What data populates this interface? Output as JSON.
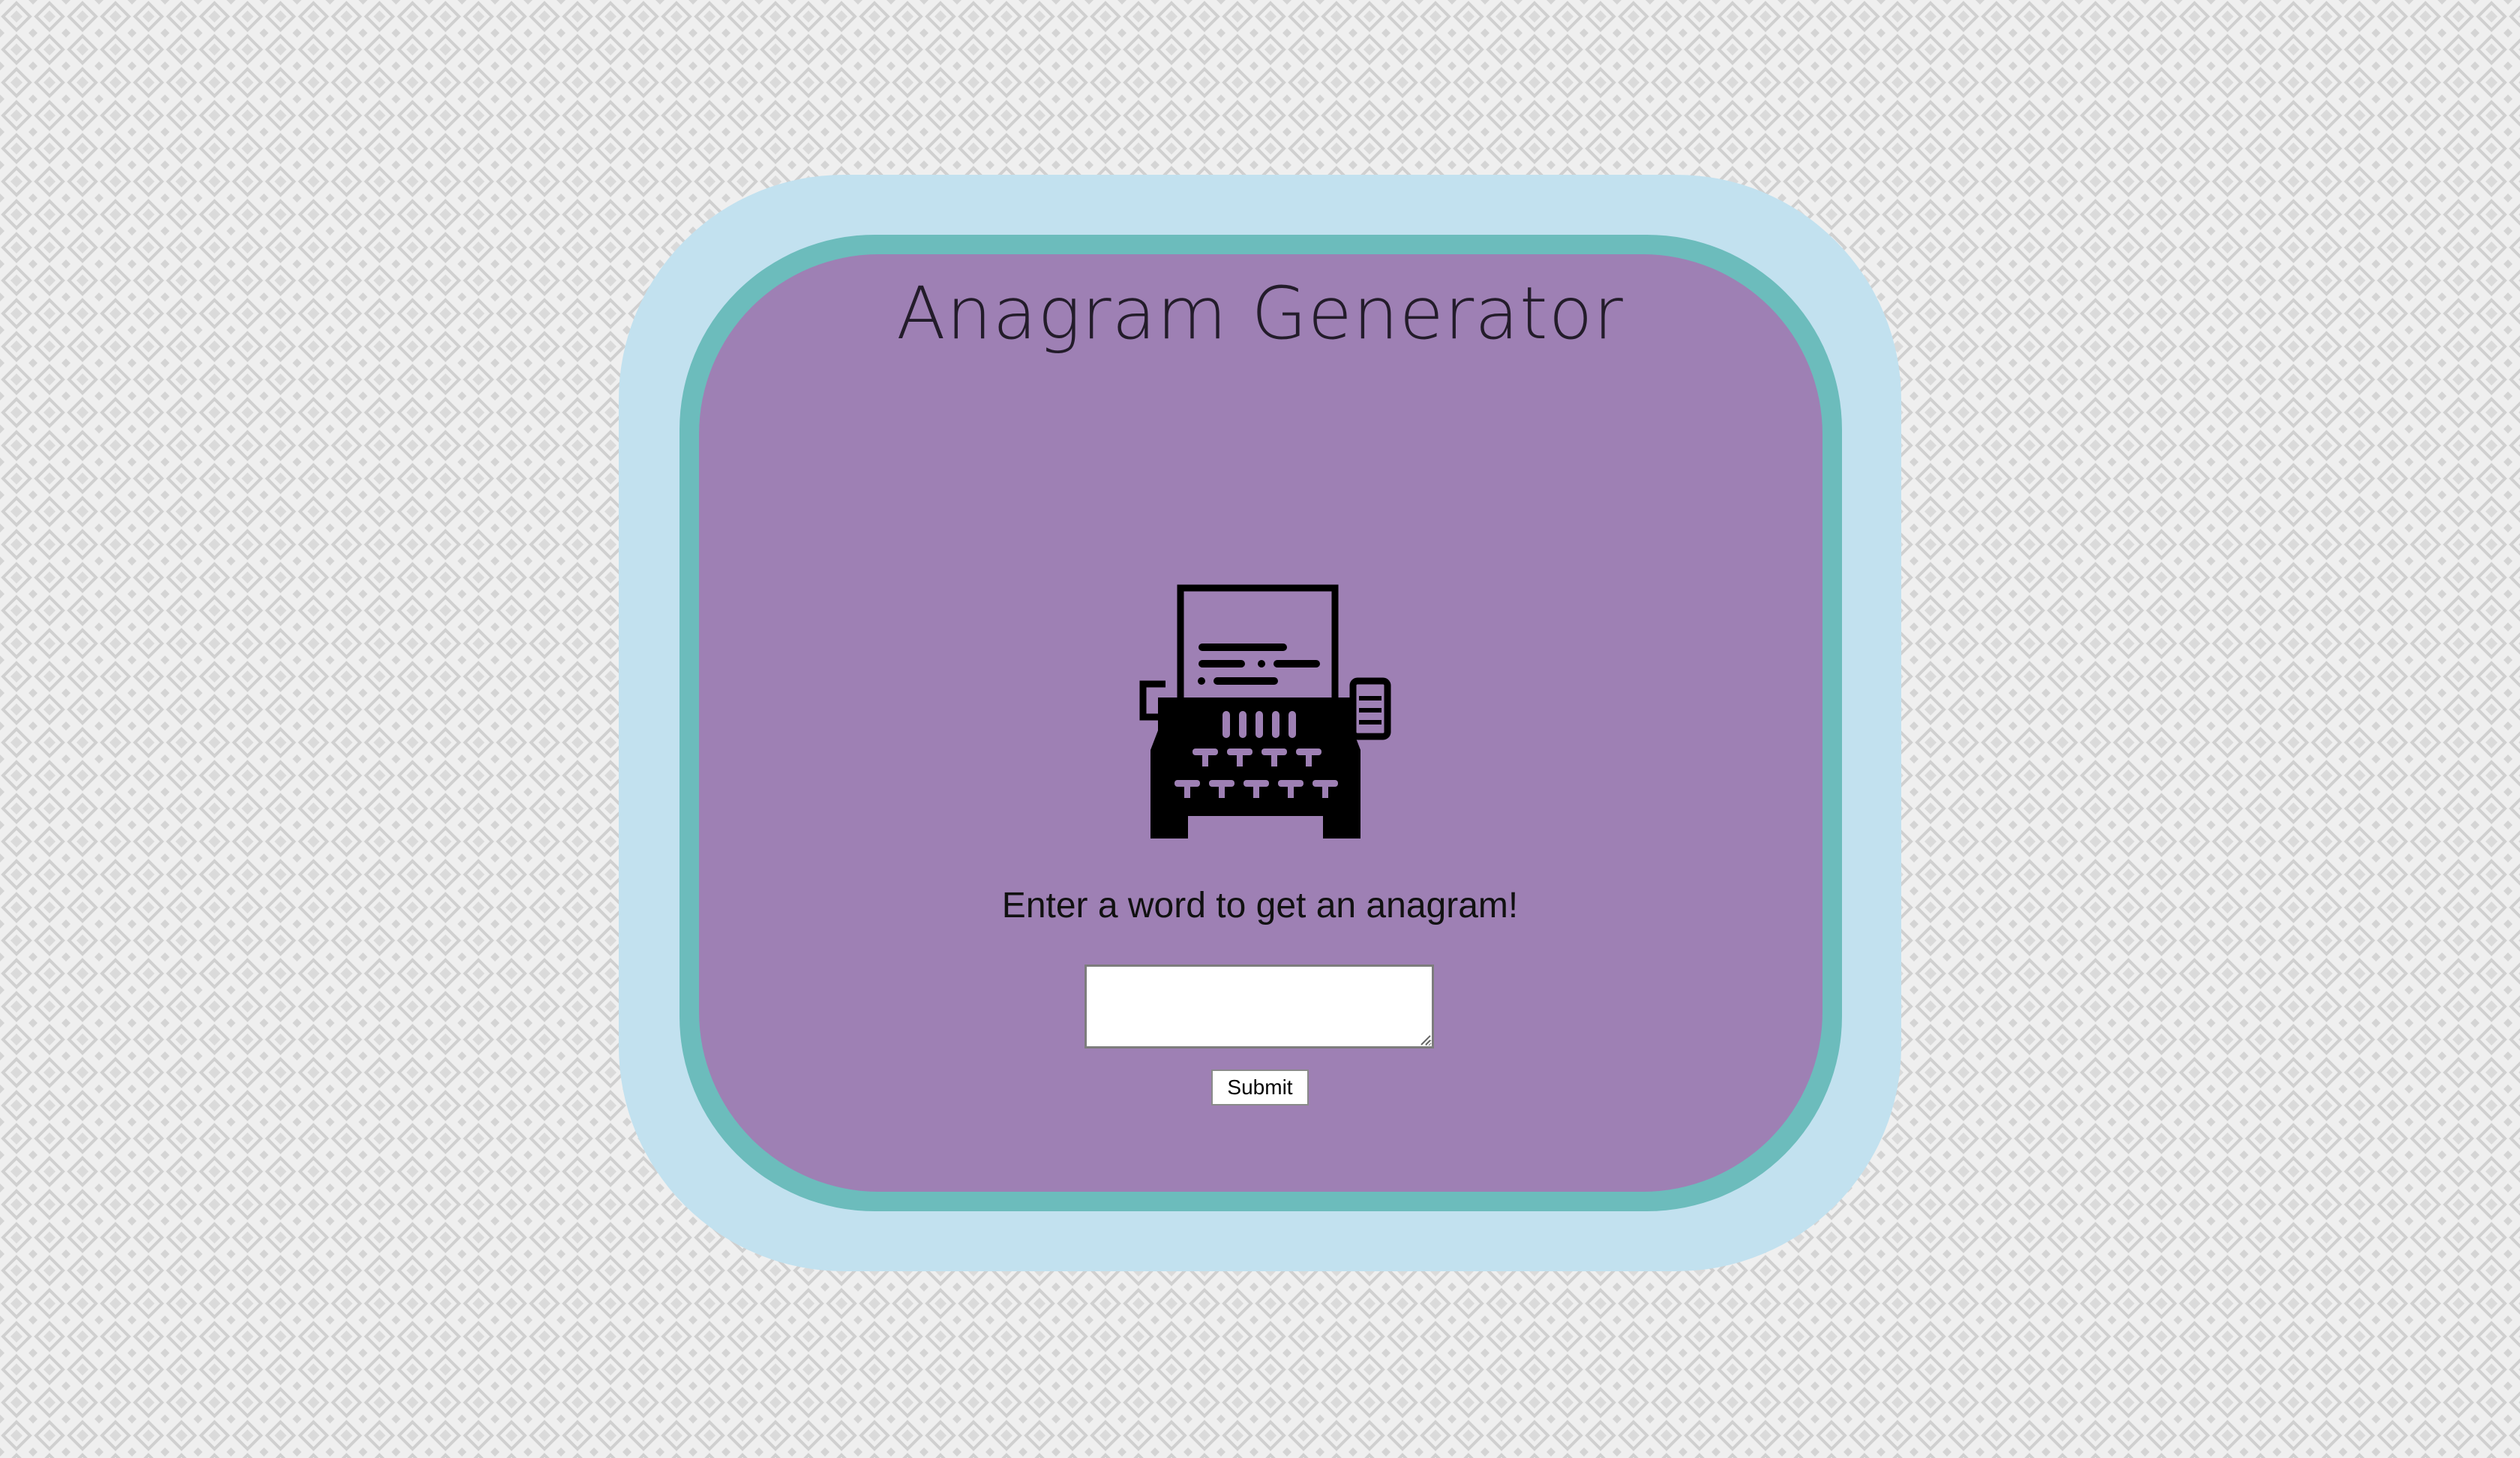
{
  "page": {
    "title": "Anagram Generator",
    "prompt": "Enter a word to get an anagram!"
  },
  "form": {
    "word_input_value": "",
    "submit_label": "Submit"
  },
  "icons": {
    "hero": "typewriter-icon"
  },
  "colors": {
    "background": "#efefef",
    "background_pattern": "#cfcfcf",
    "outer_glow": "#c2e1ef",
    "ring": "#6cbcbc",
    "card": "#9e80b4",
    "text": "#231c2a"
  }
}
